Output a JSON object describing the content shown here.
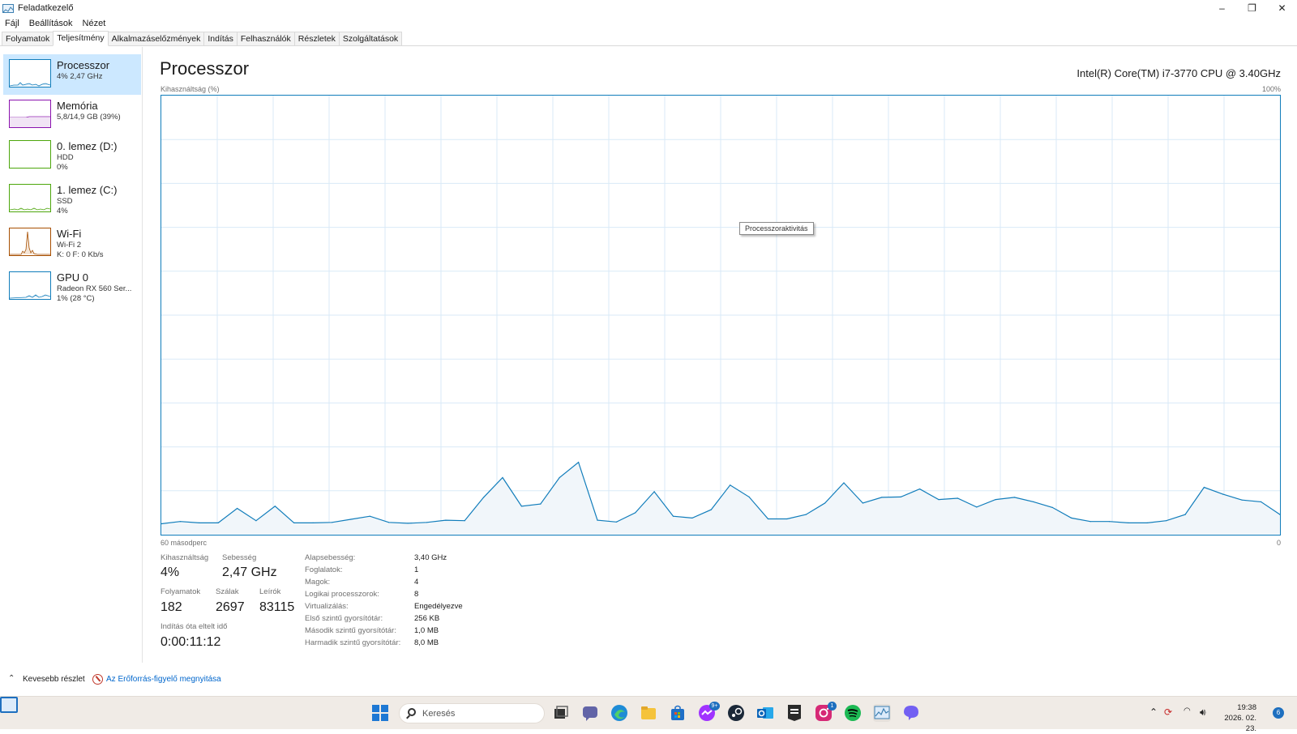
{
  "window": {
    "title": "Feladatkezelő",
    "minimize": "–",
    "restore": "❐",
    "close": "✕"
  },
  "menu": [
    "Fájl",
    "Beállítások",
    "Nézet"
  ],
  "tabs": [
    {
      "label": "Folyamatok",
      "active": false
    },
    {
      "label": "Teljesítmény",
      "active": true
    },
    {
      "label": "Alkalmazáselőzmények",
      "active": false
    },
    {
      "label": "Indítás",
      "active": false
    },
    {
      "label": "Felhasználók",
      "active": false
    },
    {
      "label": "Részletek",
      "active": false
    },
    {
      "label": "Szolgáltatások",
      "active": false
    }
  ],
  "sidebar": {
    "items": [
      {
        "name": "Processzor",
        "sub1": "4% 2,47 GHz",
        "sub2": "",
        "color": "#117dbb",
        "active": true
      },
      {
        "name": "Memória",
        "sub1": "5,8/14,9 GB (39%)",
        "sub2": "",
        "color": "#8b12ae",
        "active": false
      },
      {
        "name": "0. lemez (D:)",
        "sub1": "HDD",
        "sub2": "0%",
        "color": "#4da60c",
        "active": false
      },
      {
        "name": "1. lemez (C:)",
        "sub1": "SSD",
        "sub2": "4%",
        "color": "#4da60c",
        "active": false
      },
      {
        "name": "Wi-Fi",
        "sub1": "Wi-Fi 2",
        "sub2": "K: 0 F: 0 Kb/s",
        "color": "#a74f01",
        "active": false
      },
      {
        "name": "GPU 0",
        "sub1": "Radeon RX 560 Ser...",
        "sub2": "1% (28 °C)",
        "color": "#117dbb",
        "active": false
      }
    ]
  },
  "main": {
    "title": "Processzor",
    "cpu_model": "Intel(R) Core(TM) i7-3770 CPU @ 3.40GHz",
    "util_label": "Kihasználtság (%)",
    "max_pct": "100%",
    "time_left": "60 másodperc",
    "time_right": "0",
    "tooltip": "Processzoraktivitás"
  },
  "chart_data": {
    "type": "area",
    "ylabel": "Kihasználtság (%)",
    "ylim": [
      0,
      100
    ],
    "xlim": [
      60,
      0
    ],
    "grid": true,
    "color": "#117dbb",
    "y": [
      2.5,
      3,
      2.7,
      2.7,
      6,
      3.2,
      6.5,
      2.7,
      2.7,
      2.8,
      3.5,
      4.2,
      2.8,
      2.6,
      2.8,
      3.3,
      3.2,
      8.5,
      13,
      6.5,
      7,
      13,
      16.5,
      3.3,
      2.9,
      5,
      9.8,
      4.2,
      3.8,
      5.7,
      11.3,
      8.6,
      3.6,
      3.6,
      4.6,
      7.2,
      11.8,
      7.2,
      8.5,
      8.6,
      10.4,
      8,
      8.3,
      6.3,
      8,
      8.5,
      7.5,
      6.2,
      3.8,
      3,
      3,
      2.7,
      2.7,
      3.2,
      4.6,
      10.8,
      9.2,
      7.9,
      7.5,
      4.6
    ]
  },
  "stats": {
    "util": {
      "label": "Kihasználtság",
      "value": "4%"
    },
    "speed": {
      "label": "Sebesség",
      "value": "2,47 GHz"
    },
    "processes": {
      "label": "Folyamatok",
      "value": "182"
    },
    "threads": {
      "label": "Szálak",
      "value": "2697"
    },
    "handles": {
      "label": "Leírók",
      "value": "83115"
    },
    "uptime": {
      "label": "Indítás óta eltelt idő",
      "value": "0:00:11:12"
    }
  },
  "specs": [
    {
      "label": "Alapsebesség:",
      "value": "3,40 GHz"
    },
    {
      "label": "Foglalatok:",
      "value": "1"
    },
    {
      "label": "Magok:",
      "value": "4"
    },
    {
      "label": "Logikai processzorok:",
      "value": "8"
    },
    {
      "label": "Virtualizálás:",
      "value": "Engedélyezve"
    },
    {
      "label": "Első szintű gyorsítótár:",
      "value": "256 KB"
    },
    {
      "label": "Második szintű gyorsítótár:",
      "value": "1,0 MB"
    },
    {
      "label": "Harmadik szintű gyorsítótár:",
      "value": "8,0 MB"
    }
  ],
  "footer": {
    "fewer_details": "Kevesebb részlet",
    "resource_monitor": "Az Erőforrás-figyelő megnyitása"
  },
  "taskbar": {
    "search_placeholder": "Keresés",
    "time": "19:38",
    "date": "2026. 02. 23.",
    "notification_count": "6",
    "messenger_badge": "9+",
    "instagram_badge": "1"
  }
}
